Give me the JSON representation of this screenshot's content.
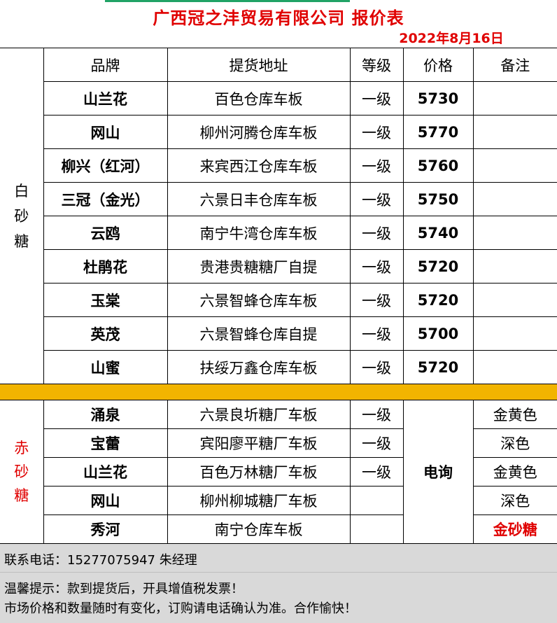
{
  "header": {
    "title": "广西冠之沣贸易有限公司  报价表",
    "date": "2022年8月16日"
  },
  "columns": [
    "品牌",
    "提货地址",
    "等级",
    "价格",
    "备注"
  ],
  "white_sugar": {
    "category": "白\n砂\n糖",
    "rows": [
      {
        "brand": "山兰花",
        "address": "百色仓库车板",
        "grade": "一级",
        "price": "5730"
      },
      {
        "brand": "网山",
        "address": "柳州河腾仓库车板",
        "grade": "一级",
        "price": "5770"
      },
      {
        "brand": "柳兴（红河）",
        "address": "来宾西江仓库车板",
        "grade": "一级",
        "price": "5760"
      },
      {
        "brand": "三冠（金光）",
        "address": "六景日丰仓库车板",
        "grade": "一级",
        "price": "5750"
      },
      {
        "brand": "云鸥",
        "address": "南宁牛湾仓库车板",
        "grade": "一级",
        "price": "5740"
      },
      {
        "brand": "杜鹃花",
        "address": "贵港贵糖糖厂自提",
        "grade": "一级",
        "price": "5720"
      },
      {
        "brand": "玉棠",
        "address": "六景智蜂仓库车板",
        "grade": "一级",
        "price": "5720"
      },
      {
        "brand": "英茂",
        "address": "六景智蜂仓库自提",
        "grade": "一级",
        "price": "5700"
      },
      {
        "brand": "山蜜",
        "address": "扶绥万鑫仓库车板",
        "grade": "一级",
        "price": "5720"
      }
    ]
  },
  "red_sugar": {
    "category": "赤\n砂\n糖",
    "price": "电询",
    "rows": [
      {
        "brand": "涌泉",
        "address": "六景良圻糖厂车板",
        "grade": "一级",
        "note": "金黄色"
      },
      {
        "brand": "宝蕾",
        "address": "宾阳廖平糖厂车板",
        "grade": "一级",
        "note": "深色"
      },
      {
        "brand": "山兰花",
        "address": "百色万林糖厂车板",
        "grade": "一级",
        "note": "金黄色"
      },
      {
        "brand": "网山",
        "address": "柳州柳城糖厂车板",
        "grade": "",
        "note": "深色"
      },
      {
        "brand": "秀河",
        "address": "南宁仓库车板",
        "grade": "",
        "note": "金砂糖"
      }
    ]
  },
  "footer": {
    "contact": "联系电话：15277075947  朱经理",
    "tip1": "温馨提示：款到提货后，开具增值税发票！",
    "tip2": "市场价格和数量随时有变化，订购请电话确认为准。合作愉快！"
  }
}
